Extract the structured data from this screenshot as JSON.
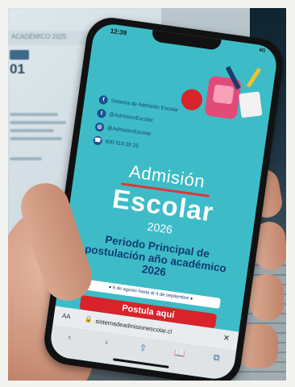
{
  "background": {
    "laptop_heading": "ACADÉMICO 2025",
    "laptop_big_text": "01"
  },
  "phone": {
    "status": {
      "time": "12:39",
      "right": "4G"
    },
    "social": [
      {
        "icon": "facebook-icon",
        "glyph": "f",
        "text": "Sistema de Admisión Escolar"
      },
      {
        "icon": "twitter-icon",
        "glyph": "t",
        "text": "@AdmisionEscolar"
      },
      {
        "icon": "instagram-icon",
        "glyph": "◎",
        "text": "@AdmisionEscolar"
      },
      {
        "icon": "phone-icon",
        "glyph": "☎",
        "text": "800 510 28 25"
      }
    ],
    "title_line1": "Admisión",
    "title_line2": "Escolar",
    "year": "2026",
    "periodo": "Periodo Principal de postulación año académico 2026",
    "date_pill": "● 6 de agosto hasta el 4 de septiembre ●",
    "cta": "Postula aquí",
    "browser": {
      "aa": "AA",
      "lock": "🔒",
      "url": "sistemadeadmisionescolar.cl",
      "close": "✕"
    },
    "toolbar": {
      "back": "‹",
      "forward": "›",
      "share": "⇧",
      "bookmarks": "📖",
      "tabs": "⧉"
    }
  },
  "colors": {
    "screen_bg": "#3dbcc7",
    "cta_red": "#d8232a",
    "navy": "#123a75"
  }
}
